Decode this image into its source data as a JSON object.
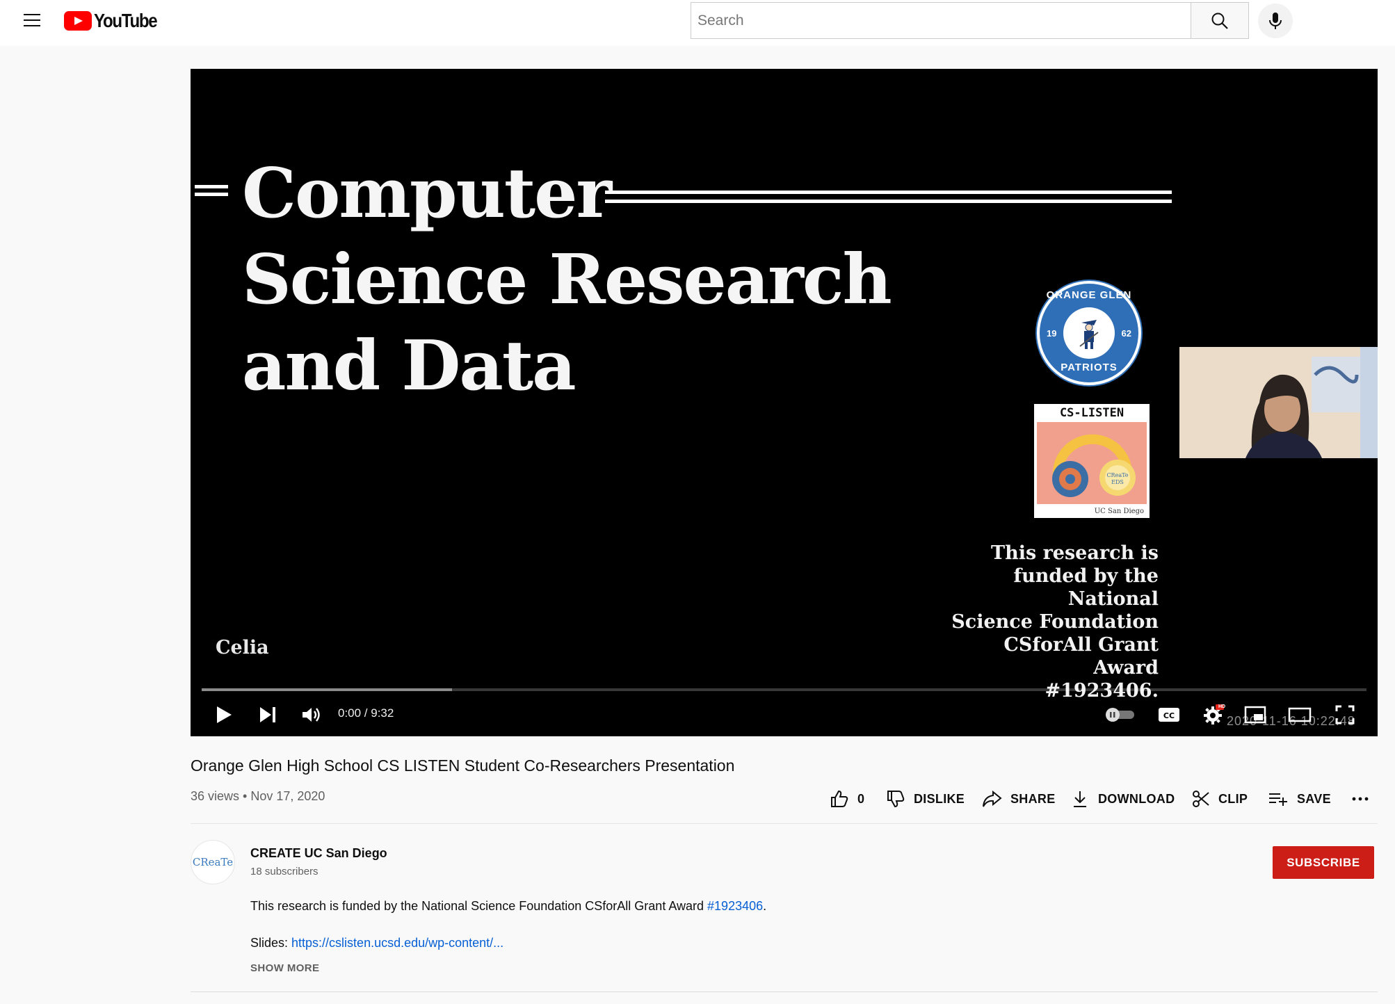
{
  "header": {
    "logo_text": "YouTube",
    "search_placeholder": "Search",
    "search_value": "",
    "icons": [
      "menu-icon",
      "search-icon",
      "mic-icon"
    ]
  },
  "player": {
    "slide_title_lines": [
      "Computer",
      "Science Research",
      "and Data"
    ],
    "presenter_name": "Celia",
    "funding_lines": [
      "This research is",
      "funded by the National",
      "Science Foundation",
      "CSforAll Grant Award",
      "#1923406."
    ],
    "seal_top": "ORANGE GLEN",
    "seal_bottom": "PATRIOTS",
    "seal_year_left": "19",
    "seal_year_right": "62",
    "cs_card_title": "CS-LISTEN",
    "cs_card_footer": "UC San Diego",
    "cs_card_badge": "CReaTe EDS",
    "time_display": "0:00 / 9:32",
    "progress_buffered": 0.215,
    "hd_badge": "HD",
    "watermark": "2020-11-16 10:22:48",
    "accent_color": "#ff0000"
  },
  "video": {
    "title": "Orange Glen High School CS LISTEN Student Co-Researchers Presentation",
    "meta": "36 views • Nov 17, 2020",
    "actions": {
      "like_count": "0",
      "dislike": "DISLIKE",
      "share": "SHARE",
      "download": "DOWNLOAD",
      "clip": "CLIP",
      "save": "SAVE"
    }
  },
  "channel": {
    "avatar_text": "CReaTe",
    "name": "CREATE UC San Diego",
    "subscribers": "18 subscribers",
    "subscribe_label": "SUBSCRIBE",
    "subscribe_color": "#cc1d17"
  },
  "description": {
    "text": "This research is funded by the National Science Foundation CSforAll Grant Award ",
    "hashtag": "#1923406",
    "text_end": ".",
    "slides_label": "Slides: ",
    "slides_link": "https://cslisten.ucsd.edu/wp-content/...",
    "show_more": "SHOW MORE"
  }
}
